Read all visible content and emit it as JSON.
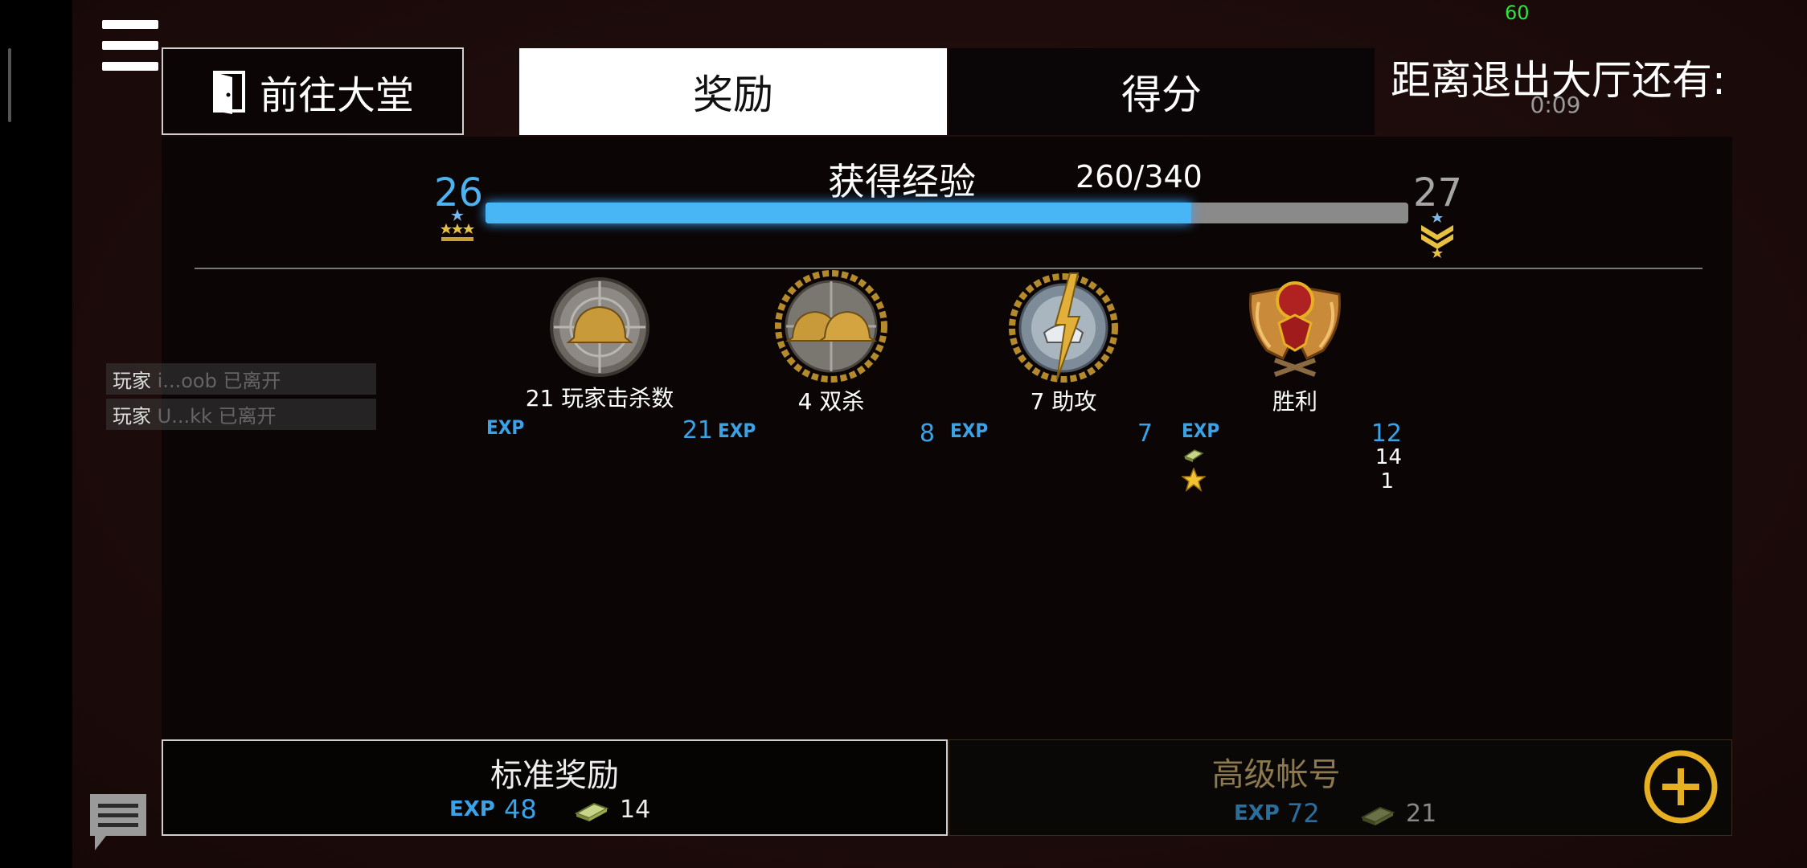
{
  "fps": "60",
  "header": {
    "lobby_label": "前往大堂",
    "tabs": [
      {
        "label": "奖励",
        "active": true
      },
      {
        "label": "得分",
        "active": false
      }
    ],
    "exit_label": "距离退出大厅还有:",
    "exit_time": "0:09"
  },
  "experience": {
    "title": "获得经验",
    "count_text": "260/340",
    "current": 260,
    "required": 340,
    "progress_fraction": 0.765,
    "level_current": "26",
    "level_next": "27"
  },
  "awards": [
    {
      "icon": "helmet-medal-icon",
      "label": "21 玩家击杀数",
      "exp_tag": "EXP",
      "exp": "21"
    },
    {
      "icon": "double-helmet-medal-icon",
      "label": "4 双杀",
      "exp_tag": "EXP",
      "exp": "8"
    },
    {
      "icon": "assist-medal-icon",
      "label": "7 助攻",
      "exp_tag": "EXP",
      "exp": "7"
    },
    {
      "icon": "victory-eagle-icon",
      "label": "胜利",
      "exp_tag": "EXP",
      "exp": "12",
      "money": "14",
      "stars": "1"
    }
  ],
  "chat_log": [
    {
      "prefix": "玩家 ",
      "name": "i...oob",
      "suffix": " 已离开"
    },
    {
      "prefix": "玩家 ",
      "name": "U...kk",
      "suffix": " 已离开"
    }
  ],
  "standard": {
    "title": "标准奖励",
    "exp_tag": "EXP",
    "exp": "48",
    "money": "14"
  },
  "premium": {
    "title": "高级帐号",
    "exp_tag": "EXP",
    "exp": "72",
    "money": "21"
  },
  "colors": {
    "accent_blue": "#48b5f5",
    "gold": "#e6b022",
    "fps_green": "#2ee63a"
  }
}
